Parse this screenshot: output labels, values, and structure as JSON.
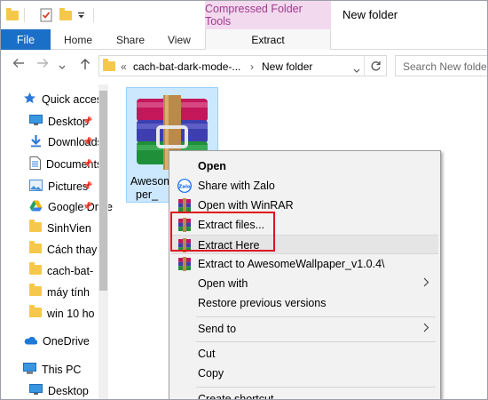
{
  "window": {
    "title": "New folder",
    "context_tab_title": "Compressed Folder Tools"
  },
  "ribbon": {
    "tabs": [
      {
        "label": "File"
      },
      {
        "label": "Home"
      },
      {
        "label": "Share"
      },
      {
        "label": "View"
      },
      {
        "label": "Extract"
      }
    ]
  },
  "address": {
    "prefix": "«",
    "segments": [
      "cach-bat-dark-mode-...",
      "New folder"
    ],
    "separator": "›",
    "search_placeholder": "Search New folder"
  },
  "sidebar": {
    "items": [
      {
        "label": "Quick access",
        "icon": "star-icon"
      },
      {
        "label": "Desktop",
        "icon": "desktop-icon",
        "pinned": true
      },
      {
        "label": "Downloads",
        "icon": "download-icon",
        "pinned": true
      },
      {
        "label": "Documents",
        "icon": "document-icon",
        "pinned": true
      },
      {
        "label": "Pictures",
        "icon": "pictures-icon",
        "pinned": true
      },
      {
        "label": "Google Drive",
        "icon": "google-drive-icon",
        "pinned": true
      },
      {
        "label": "SinhVien",
        "icon": "folder-icon"
      },
      {
        "label": "Cách thay",
        "icon": "folder-icon"
      },
      {
        "label": "cach-bat-",
        "icon": "folder-icon"
      },
      {
        "label": "máy tính",
        "icon": "folder-icon"
      },
      {
        "label": "win 10 ho",
        "icon": "folder-icon"
      },
      {
        "label": "OneDrive",
        "icon": "onedrive-icon"
      },
      {
        "label": "This PC",
        "icon": "computer-icon"
      },
      {
        "label": "Desktop",
        "icon": "desktop-icon"
      }
    ]
  },
  "file": {
    "name_line1": "Awesom",
    "name_line2": "per_",
    "icon": "winrar-archive-icon"
  },
  "context_menu": {
    "items": [
      {
        "label": "Open",
        "bold": true
      },
      {
        "label": "Share with Zalo",
        "icon": "zalo-icon"
      },
      {
        "label": "Open with WinRAR",
        "icon": "winrar-icon"
      },
      {
        "label": "Extract files...",
        "icon": "winrar-icon"
      },
      {
        "label": "Extract Here",
        "icon": "winrar-icon"
      },
      {
        "label": "Extract to AwesomeWallpaper_v1.0.4\\",
        "icon": "winrar-icon"
      },
      {
        "label": "Open with",
        "submenu": true
      },
      {
        "label": "Restore previous versions"
      },
      {
        "label": "Send to",
        "submenu": true
      },
      {
        "label": "Cut"
      },
      {
        "label": "Copy"
      },
      {
        "label": "Create shortcut"
      }
    ]
  },
  "colors": {
    "file_tab": "#1a6fc6",
    "context_tab_bg": "#f3d9ee",
    "context_tab_text": "#9e3b8e",
    "selection": "#cce8ff",
    "highlight_box": "#e0141f"
  }
}
